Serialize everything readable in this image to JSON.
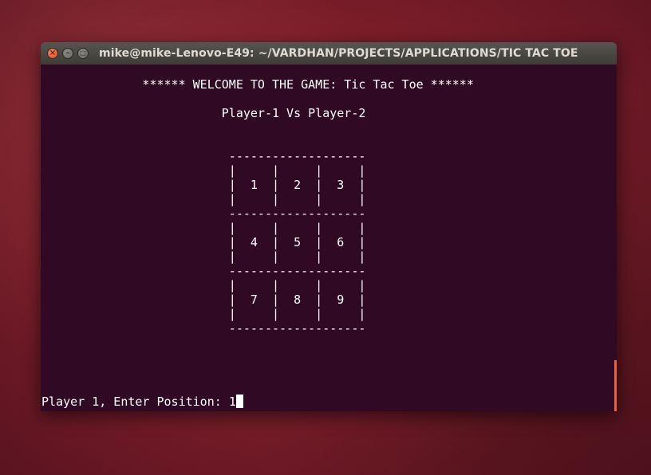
{
  "window": {
    "title": "mike@mike-Lenovo-E49: ~/VARDHAN/PROJECTS/APPLICATIONS/TIC TAC TOE",
    "controls": {
      "close": "×",
      "minimize": "–",
      "maximize": "□"
    }
  },
  "terminal": {
    "background": "#300a24",
    "text_color": "#ffffff",
    "output": "              ****** WELCOME TO THE GAME: Tic Tac Toe ******\n\n                         Player-1 Vs Player-2\n\n\n                          -------------------\n                          |     |     |     |\n                          |  1  |  2  |  3  |\n                          |     |     |     |\n                          -------------------\n                          |     |     |     |\n                          |  4  |  5  |  6  |\n                          |     |     |     |\n                          -------------------\n                          |     |     |     |\n                          |  7  |  8  |  9  |\n                          |     |     |     |\n                          -------------------",
    "prompt": "Player 1, Enter Position: ",
    "input_value": "1"
  }
}
